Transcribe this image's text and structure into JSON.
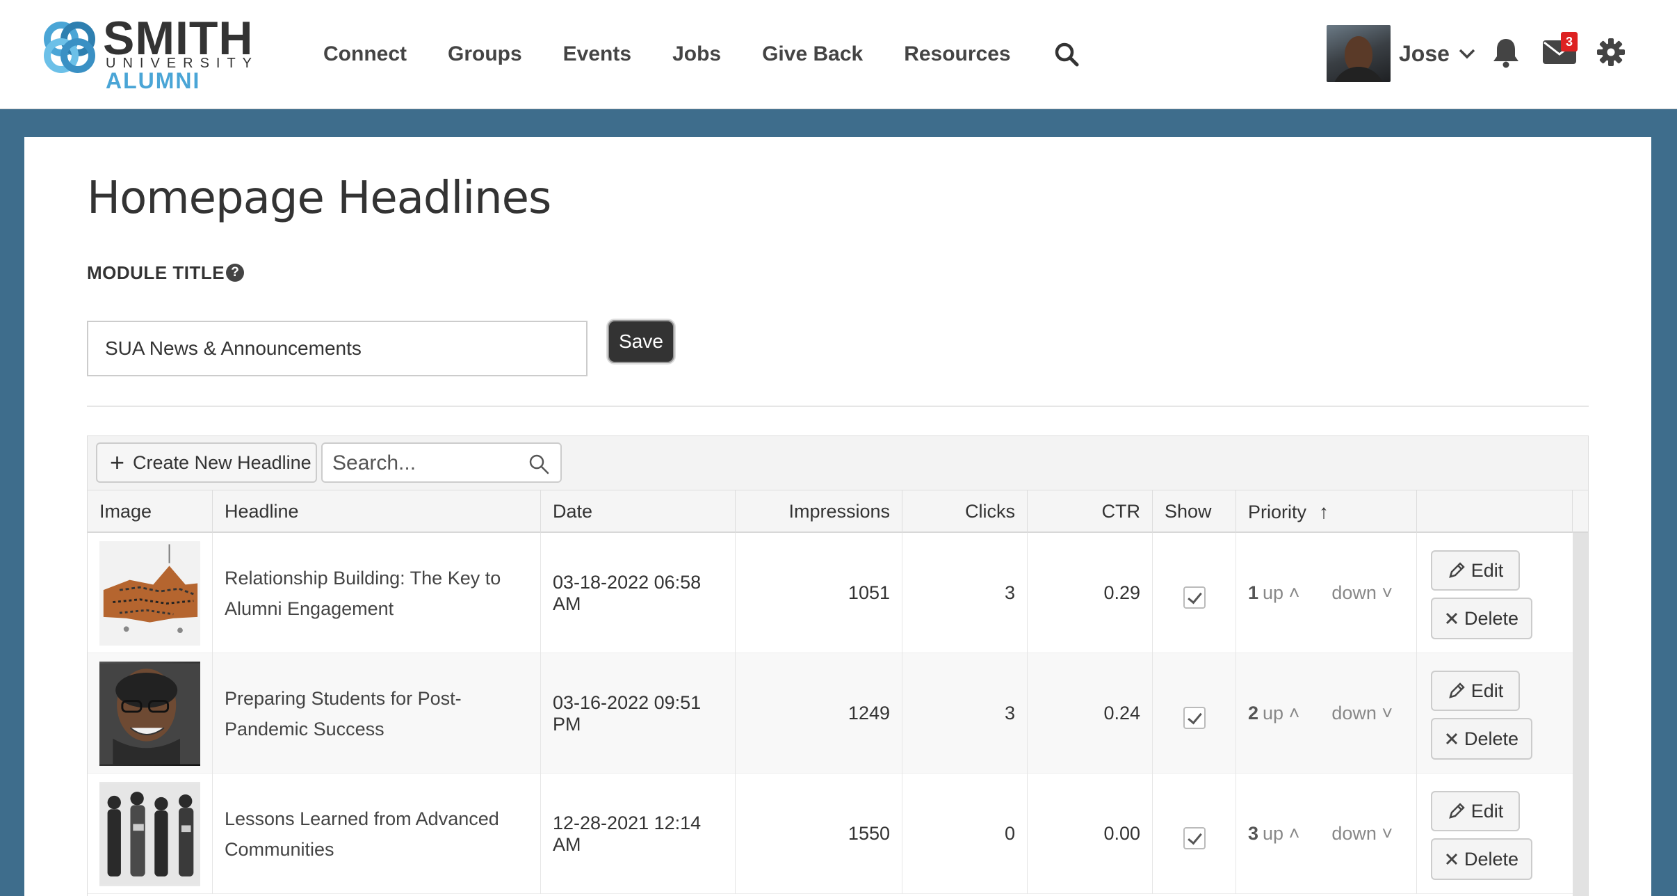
{
  "brand": {
    "smith": "SMITH",
    "university": "UNIVERSITY",
    "alumni": "ALUMNI",
    "accent": "#4aa5d6"
  },
  "nav": {
    "items": [
      {
        "label": "Connect"
      },
      {
        "label": "Groups"
      },
      {
        "label": "Events"
      },
      {
        "label": "Jobs"
      },
      {
        "label": "Give Back"
      },
      {
        "label": "Resources"
      }
    ]
  },
  "user": {
    "name": "Jose",
    "mail_count": "3"
  },
  "page": {
    "title": "Homepage Headlines",
    "module_label": "MODULE TITLE",
    "module_value": "SUA News & Announcements",
    "save_label": "Save",
    "help_glyph": "?"
  },
  "toolbar": {
    "create_label": "Create New Headline",
    "search_placeholder": "Search..."
  },
  "table": {
    "headers": {
      "image": "Image",
      "headline": "Headline",
      "date": "Date",
      "impressions": "Impressions",
      "clicks": "Clicks",
      "ctr": "CTR",
      "show": "Show",
      "priority": "Priority"
    },
    "rows": [
      {
        "headline": "Relationship Building: The Key to Alumni Engagement",
        "date": "03-18-2022 06:58 AM",
        "impressions": "1051",
        "clicks": "3",
        "ctr": "0.29",
        "show": true,
        "priority": "1",
        "up": "up",
        "down": "down",
        "edit": "Edit",
        "delete": "Delete"
      },
      {
        "headline": "Preparing Students for Post-Pandemic Success",
        "date": "03-16-2022 09:51 PM",
        "impressions": "1249",
        "clicks": "3",
        "ctr": "0.24",
        "show": true,
        "priority": "2",
        "up": "up",
        "down": "down",
        "edit": "Edit",
        "delete": "Delete"
      },
      {
        "headline": "Lessons Learned from Advanced Communities",
        "date": "12-28-2021 12:14 AM",
        "impressions": "1550",
        "clicks": "0",
        "ctr": "0.00",
        "show": true,
        "priority": "3",
        "up": "up",
        "down": "down",
        "edit": "Edit",
        "delete": "Delete"
      }
    ]
  },
  "icons": {
    "search": "search-icon",
    "bell": "bell-icon",
    "mail": "envelope-icon",
    "gear": "gear-icon",
    "help": "question-circle-icon",
    "plus": "plus-icon",
    "edit": "pencil-icon",
    "delete": "x-icon",
    "sort": "arrow-up-icon"
  },
  "colors": {
    "page_bg": "#3e6d8c",
    "save_bg": "#333333",
    "badge": "#dd2222"
  }
}
